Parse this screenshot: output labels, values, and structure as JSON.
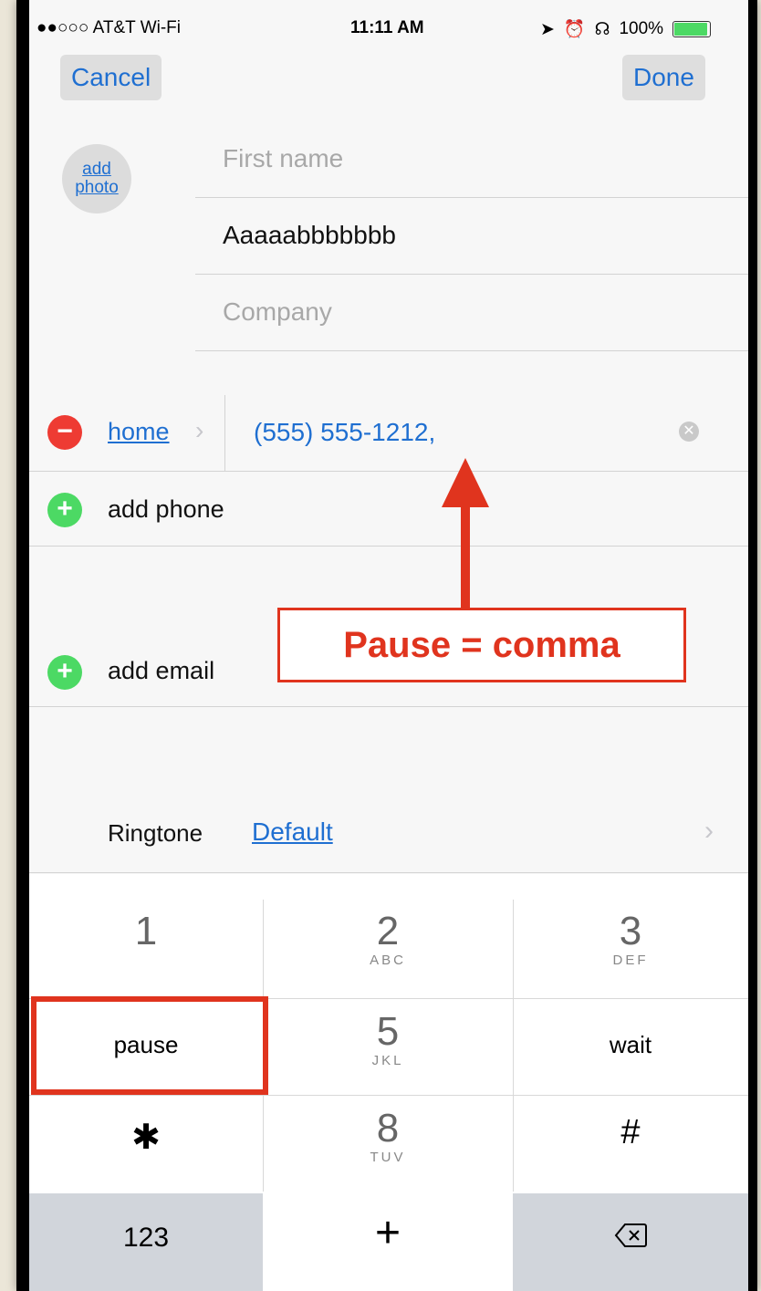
{
  "status": {
    "carrier": "●●○○○ AT&T Wi-Fi",
    "time": "11:11 AM",
    "battery": "100%"
  },
  "nav": {
    "cancel": "Cancel",
    "done": "Done"
  },
  "contact": {
    "add_photo": [
      "add",
      "photo"
    ],
    "first_name_placeholder": "First name",
    "last_name_value": "Aaaaabbbbbbb",
    "company_placeholder": "Company"
  },
  "phone": {
    "label": "home",
    "value": "(555) 555-1212,"
  },
  "actions": {
    "add_phone": "add phone",
    "add_email": "add email"
  },
  "annotation": {
    "text": "Pause = comma"
  },
  "ringtone": {
    "label": "Ringtone",
    "value": "Default"
  },
  "keypad": {
    "k1": {
      "num": "1",
      "sub": ""
    },
    "k2": {
      "num": "2",
      "sub": "ABC"
    },
    "k3": {
      "num": "3",
      "sub": "DEF"
    },
    "pause": "pause",
    "k5": {
      "num": "5",
      "sub": "JKL"
    },
    "wait": "wait",
    "star": "✱",
    "k8": {
      "num": "8",
      "sub": "TUV"
    },
    "hash": "#",
    "mode": "123",
    "plus": "+",
    "delete_icon": "backspace-icon"
  },
  "colors": {
    "accent": "#1f6fd1",
    "annotation": "#e0341e",
    "remove": "#ee3b33",
    "add": "#4cd964"
  }
}
